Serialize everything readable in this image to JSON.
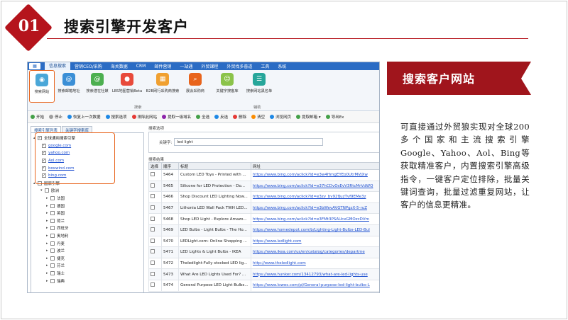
{
  "slide": {
    "number": "01",
    "title": "搜索引擎开发客户",
    "accent_color": "#b5141c"
  },
  "app": {
    "menu_icon": "menu-grid-icon",
    "menu": [
      "信息搜索",
      "营销CEO/采购",
      "海关数据",
      "CRM",
      "邮件营销",
      "一站通",
      "外贸课程",
      "外贸找多普道",
      "工具",
      "系统"
    ],
    "ribbon_buttons": [
      {
        "label": "搜索网站",
        "icon": "globe-search-icon",
        "color": "#4aa7d8"
      },
      {
        "label": "搜索邮箱地址",
        "icon": "at-sign-icon",
        "color": "#3b8fd6"
      },
      {
        "label": "搜索潜在社媒",
        "icon": "social-at-icon",
        "color": "#4caf50"
      },
      {
        "label": "LBS地图营销Beta",
        "icon": "map-pin-icon",
        "color": "#e84a3b"
      },
      {
        "label": "B2B网行采购商搜索",
        "icon": "b2b-grid-icon",
        "color": "#f0a030"
      },
      {
        "label": "展会采购商",
        "icon": "magnifier-icon",
        "color": "#e8641c"
      },
      {
        "label": "关键字搜客库",
        "icon": "keyword-person-icon",
        "color": "#8bc34a"
      },
      {
        "label": "搜索网站黑名单",
        "icon": "blacklist-icon",
        "color": "#26a69a"
      }
    ],
    "ribbon_groups": [
      "搜索",
      "辅助"
    ],
    "toolbar": [
      {
        "label": "开始",
        "color": "#43a047"
      },
      {
        "label": "停止",
        "color": "#9e9e9e"
      },
      {
        "label": "恢复上一次数据",
        "color": "#1e88e5"
      },
      {
        "label": "搜索选项",
        "color": "#1e88e5"
      },
      {
        "label": "排除此网站",
        "color": "#e53935"
      },
      {
        "label": "提取一级域名",
        "color": "#8e24aa"
      },
      {
        "label": "全选",
        "color": "#43a047"
      },
      {
        "label": "反选",
        "color": "#1e88e5"
      },
      {
        "label": "删除",
        "color": "#e53935"
      },
      {
        "label": "清空",
        "color": "#fb8c00"
      },
      {
        "label": "浏览网页",
        "color": "#1e88e5"
      },
      {
        "label": "提取邮箱 ▾",
        "color": "#43a047"
      },
      {
        "label": "导出Ex",
        "color": "#43a047"
      }
    ],
    "left_tabs": [
      "搜索引擎列表",
      "关键字搜索库"
    ],
    "tree": [
      {
        "level": 1,
        "toggle": "▴",
        "checked": true,
        "label": "全球通用搜索引擎",
        "link": false
      },
      {
        "level": 2,
        "toggle": "",
        "checked": true,
        "label": "google.com",
        "link": true
      },
      {
        "level": 2,
        "toggle": "",
        "checked": true,
        "label": "yahoo.com",
        "link": true
      },
      {
        "level": 2,
        "toggle": "",
        "checked": true,
        "label": "Aol.com",
        "link": true
      },
      {
        "level": 2,
        "toggle": "",
        "checked": true,
        "label": "boxwind.com",
        "link": true
      },
      {
        "level": 2,
        "toggle": "",
        "checked": true,
        "label": "bing.com",
        "link": true
      },
      {
        "level": 1,
        "toggle": "▴",
        "checked": false,
        "label": "国家引擎",
        "link": false
      },
      {
        "level": 2,
        "toggle": "▾",
        "checked": false,
        "label": "欧洲",
        "link": false
      },
      {
        "level": 3,
        "toggle": "▸",
        "checked": false,
        "label": "法国",
        "link": false
      },
      {
        "level": 3,
        "toggle": "▸",
        "checked": false,
        "label": "德国",
        "link": false
      },
      {
        "level": 3,
        "toggle": "▸",
        "checked": false,
        "label": "英国",
        "link": false
      },
      {
        "level": 3,
        "toggle": "▸",
        "checked": false,
        "label": "荷兰",
        "link": false
      },
      {
        "level": 3,
        "toggle": "▸",
        "checked": false,
        "label": "西班牙",
        "link": false
      },
      {
        "level": 3,
        "toggle": "▸",
        "checked": false,
        "label": "奥地利",
        "link": false
      },
      {
        "level": 3,
        "toggle": "▸",
        "checked": false,
        "label": "丹麦",
        "link": false
      },
      {
        "level": 3,
        "toggle": "▸",
        "checked": false,
        "label": "波兰",
        "link": false
      },
      {
        "level": 3,
        "toggle": "▸",
        "checked": false,
        "label": "捷克",
        "link": false
      },
      {
        "level": 3,
        "toggle": "▸",
        "checked": false,
        "label": "芬兰",
        "link": false
      },
      {
        "level": 3,
        "toggle": "▸",
        "checked": false,
        "label": "瑞士",
        "link": false
      },
      {
        "level": 3,
        "toggle": "▸",
        "checked": false,
        "label": "瑞典",
        "link": false
      }
    ],
    "search_options_label": "搜索选项",
    "keyword_label": "关键字:",
    "keyword_value": "led light",
    "results_label": "搜索结果",
    "results_headers": [
      "选择",
      "顺序",
      "标题",
      "网址"
    ],
    "results": [
      {
        "order": "5464",
        "title": "Custom LED Toys - Printed with ...",
        "url": "https://www.bing.com/aclick?ld=e3w4HmgEYEo0UtrMVJXw"
      },
      {
        "order": "5465",
        "title": "Silicone for LED Protection - Do...",
        "url": "https://www.bing.com/aclick?ld=e37hCDvOsEvV3RtcMrVdWQ"
      },
      {
        "order": "5466",
        "title": "Shop Discount LED Lighting Now...",
        "url": "https://www.bing.com/aclick?ld=e3zv_bv92fJuzTvf9EMe3z"
      },
      {
        "order": "5467",
        "title": "Lithonia LED Wall Pack TWH LED...",
        "url": "https://www.bing.com/aclick?ld=e3bWevAVGTNPgzX-5-ruZ"
      },
      {
        "order": "5468",
        "title": "Shop LED Light - Explore Amazo...",
        "url": "https://www.bing.com/aclick?ld=e3FMt3PSAUcxGMOzcDVm"
      },
      {
        "order": "5469",
        "title": "LED Bulbs - Light Bulbs - The Ho...",
        "url": "https://www.homedepot.com/b/Lighting-Light-Bulbs-LED-Bul"
      },
      {
        "order": "5470",
        "title": "LEDLight.com: Online Shopping ...",
        "url": "https://www.ledlight.com"
      },
      {
        "order": "5471",
        "title": "LED Lights & Light Bulbs - IKEA",
        "url": "https://www.ikea.com/us/en/catalog/categories/departme"
      },
      {
        "order": "5472",
        "title": "Theledlight-Fully stocked LED lig...",
        "url": "http://www.theledlight.com"
      },
      {
        "order": "5473",
        "title": "What Are LED Lights Used For? ...",
        "url": "https://www.hunker.com/13412793/what-are-led-lights-use"
      },
      {
        "order": "5474",
        "title": "General Purpose LED Light Bulbs...",
        "url": "https://www.lowes.com/pl/General-purpose-led-light-bulbs-L"
      }
    ]
  },
  "panel": {
    "banner_title": "搜索客户网站",
    "description": "可直接通过外贸狼实现对全球200多个国家和主流搜索引擎Google、Yahoo、Aol、Bing等获取精准客户，内置搜索引擎高级指令，一键客户定位排除，批量关键词查询，批量过滤重复网站，让客户的信息更精准。"
  }
}
